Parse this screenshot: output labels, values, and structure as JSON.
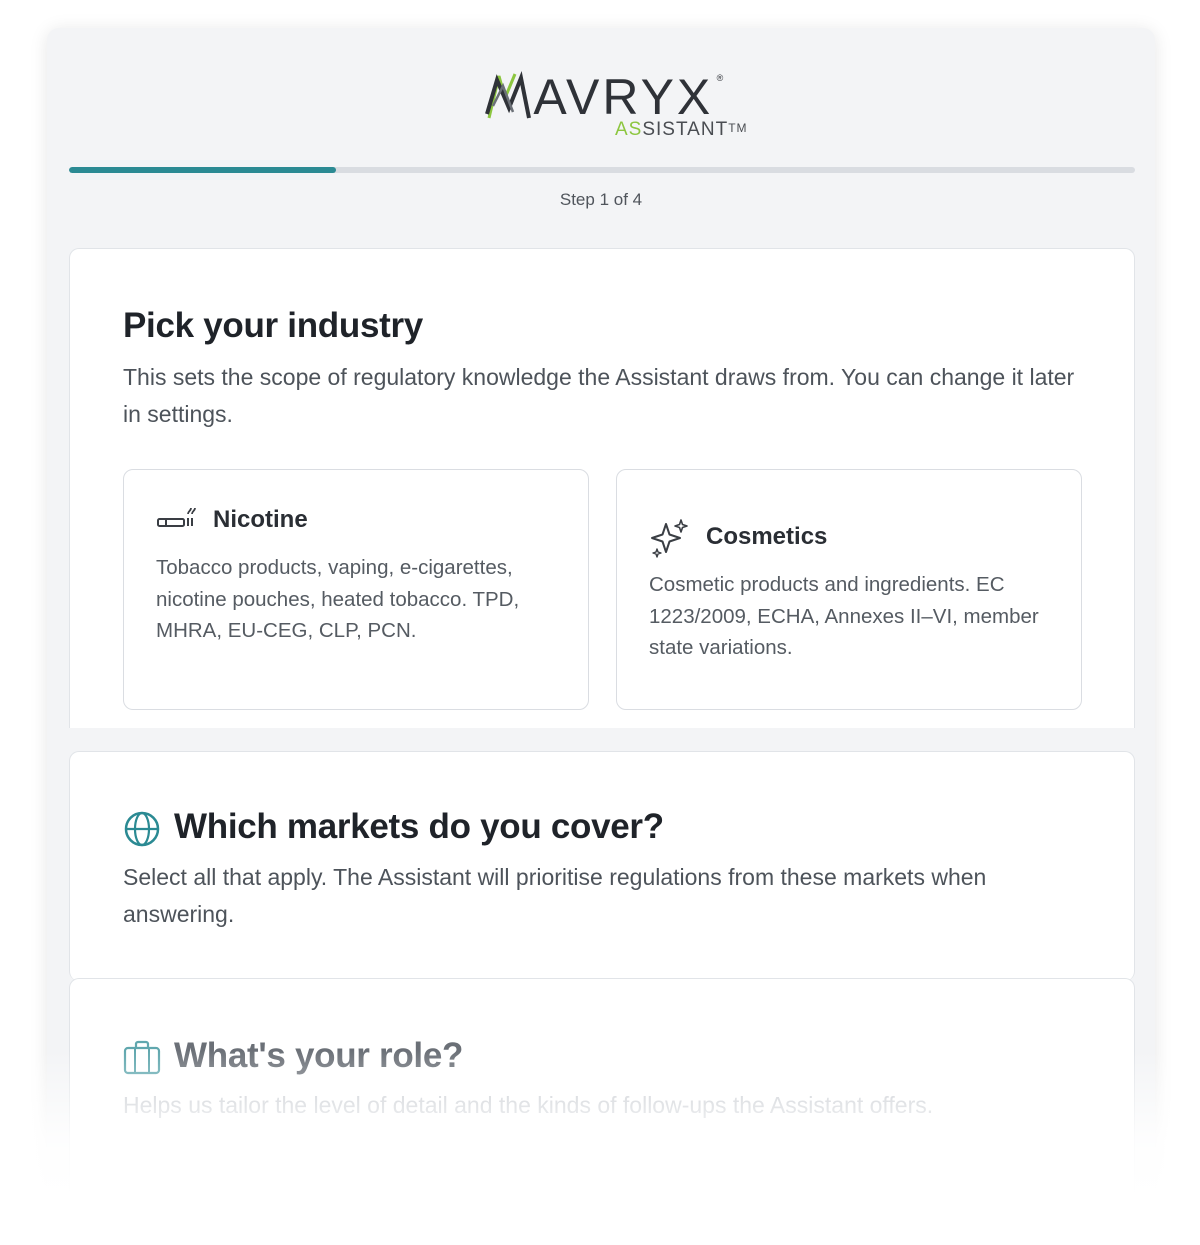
{
  "brand": {
    "wordmark_first": "M",
    "wordmark_rest": "AVRYX",
    "wordmark_tm": "®",
    "sub_green": "AS",
    "sub_rest": "SISTANT",
    "sub_tm": "TM",
    "colors": {
      "dark": "#2f3238",
      "green": "#8cc63f",
      "teal": "#2b8a93"
    }
  },
  "progress": {
    "label": "Step 1 of 4",
    "current_step": 1,
    "total_steps": 4,
    "fraction": 0.25
  },
  "industry": {
    "title": "Pick your industry",
    "description": "This sets the scope of regulatory knowledge the Assistant draws from. You can change it later in settings.",
    "options": [
      {
        "icon": "cigarette-icon",
        "label": "Nicotine",
        "description": "Tobacco products, vaping, e-cigarettes, nicotine pouches, heated tobacco. TPD, MHRA, EU-CEG, CLP, PCN."
      },
      {
        "icon": "sparkles-icon",
        "label": "Cosmetics",
        "description": "Cosmetic products and ingredients. EC 1223/2009, ECHA, Annexes II–VI, member state variations."
      }
    ]
  },
  "markets": {
    "icon": "globe-icon",
    "title": "Which markets do you cover?",
    "description": "Select all that apply. The Assistant will prioritise regulations from these markets when answering."
  },
  "role": {
    "icon": "briefcase-icon",
    "title": "What's your role?",
    "description": "Helps us tailor the level of detail and the kinds of follow-ups the Assistant offers."
  }
}
